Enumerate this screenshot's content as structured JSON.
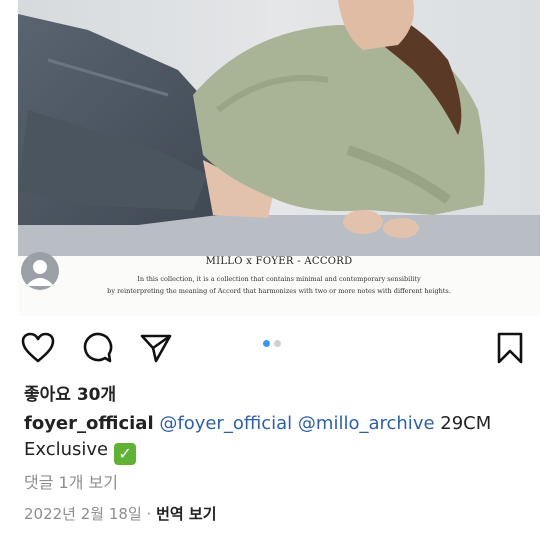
{
  "image": {
    "caption_title": "MILLO x FOYER - ACCORD",
    "caption_line1": "In this collection, it is a collection that contains minimal and contemporary sensibility",
    "caption_line2": "by reinterpreting the meaning of Accord that harmonizes with two or more notes with different heights."
  },
  "actions": {
    "icons": [
      "heart-icon",
      "comment-icon",
      "send-icon",
      "bookmark-icon"
    ],
    "carousel": {
      "count": 2,
      "active_index": 0
    }
  },
  "post": {
    "likes": "좋아요 30개",
    "username": "foyer_official",
    "mention1": "@foyer_official",
    "mention2": "@millo_archive",
    "caption_text": "29CM",
    "caption_line2": "Exclusive",
    "check_emoji": "✓",
    "view_comments": "댓글 1개 보기",
    "date": "2022년 2월 18일",
    "separator": "·",
    "translate": "번역 보기"
  },
  "colors": {
    "mention": "#2f5fa6",
    "carousel_active": "#3897f0",
    "muted_text": "#8e8e8e"
  }
}
